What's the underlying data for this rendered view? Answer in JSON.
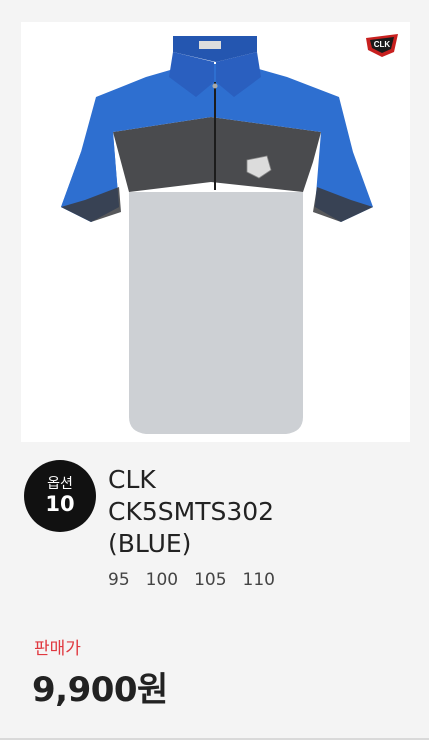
{
  "product": {
    "image_alt": "CLK polo shirt",
    "logo_text": "CLK",
    "option_label": "옵션",
    "option_count": "10",
    "brand": "CLK",
    "name_line1": "CK5SMTS302",
    "name_line2": "(BLUE)",
    "sizes": [
      "95",
      "100",
      "105",
      "110"
    ],
    "price_label": "판매가",
    "price": "9,900원"
  },
  "colors": {
    "shirt_blue": "#2e6fd0",
    "shirt_dark": "#4a4b4e",
    "shirt_light": "#cdd0d4",
    "price_label": "#e0383f"
  }
}
